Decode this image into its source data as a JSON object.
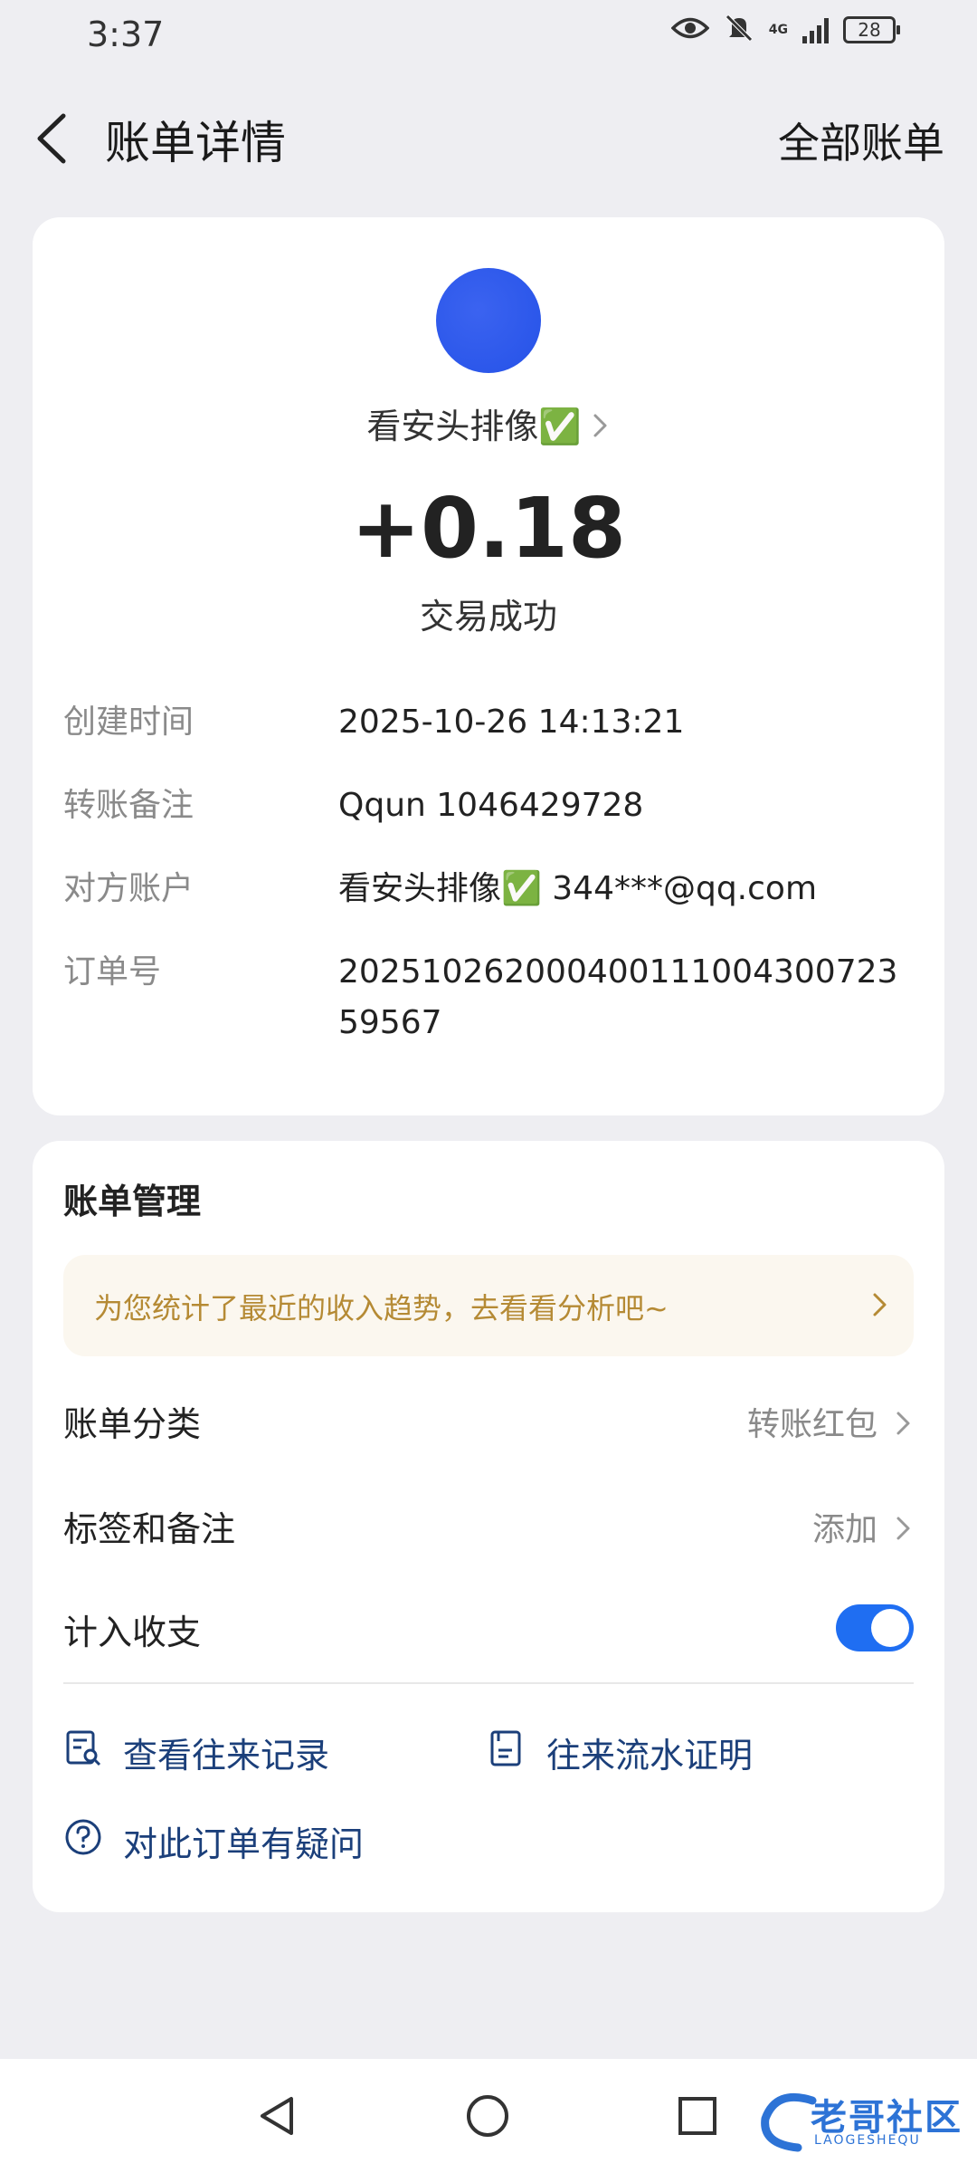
{
  "status_bar": {
    "time": "3:37",
    "battery": "28",
    "network": "4G"
  },
  "header": {
    "title": "账单详情",
    "right_link": "全部账单"
  },
  "summary": {
    "payee": "看安头排像✅",
    "amount": "+0.18",
    "status": "交易成功",
    "avatar_color": "#2f5cf0"
  },
  "details": [
    {
      "label": "创建时间",
      "value": "2025-10-26 14:13:21"
    },
    {
      "label": "转账备注",
      "value": "Qqun 1046429728"
    },
    {
      "label": "对方账户",
      "value": "看安头排像✅ 344***@qq.com"
    },
    {
      "label": "订单号",
      "value": "20251026200040011100430072359567"
    }
  ],
  "management": {
    "title": "账单管理",
    "tip": "为您统计了最近的收入趋势，去看看分析吧~",
    "category_label": "账单分类",
    "category_value": "转账红包",
    "tags_label": "标签和备注",
    "tags_value": "添加",
    "include_label": "计入收支",
    "include_on": true,
    "actions": {
      "records": "查看往来记录",
      "proof": "往来流水证明",
      "question": "对此订单有疑问"
    }
  },
  "watermark": {
    "text": "老哥社区",
    "sub": "LAOGESHEQU"
  },
  "colors": {
    "accent": "#1f6ef2",
    "tip_text": "#b58a34",
    "link": "#1b3f7a"
  }
}
